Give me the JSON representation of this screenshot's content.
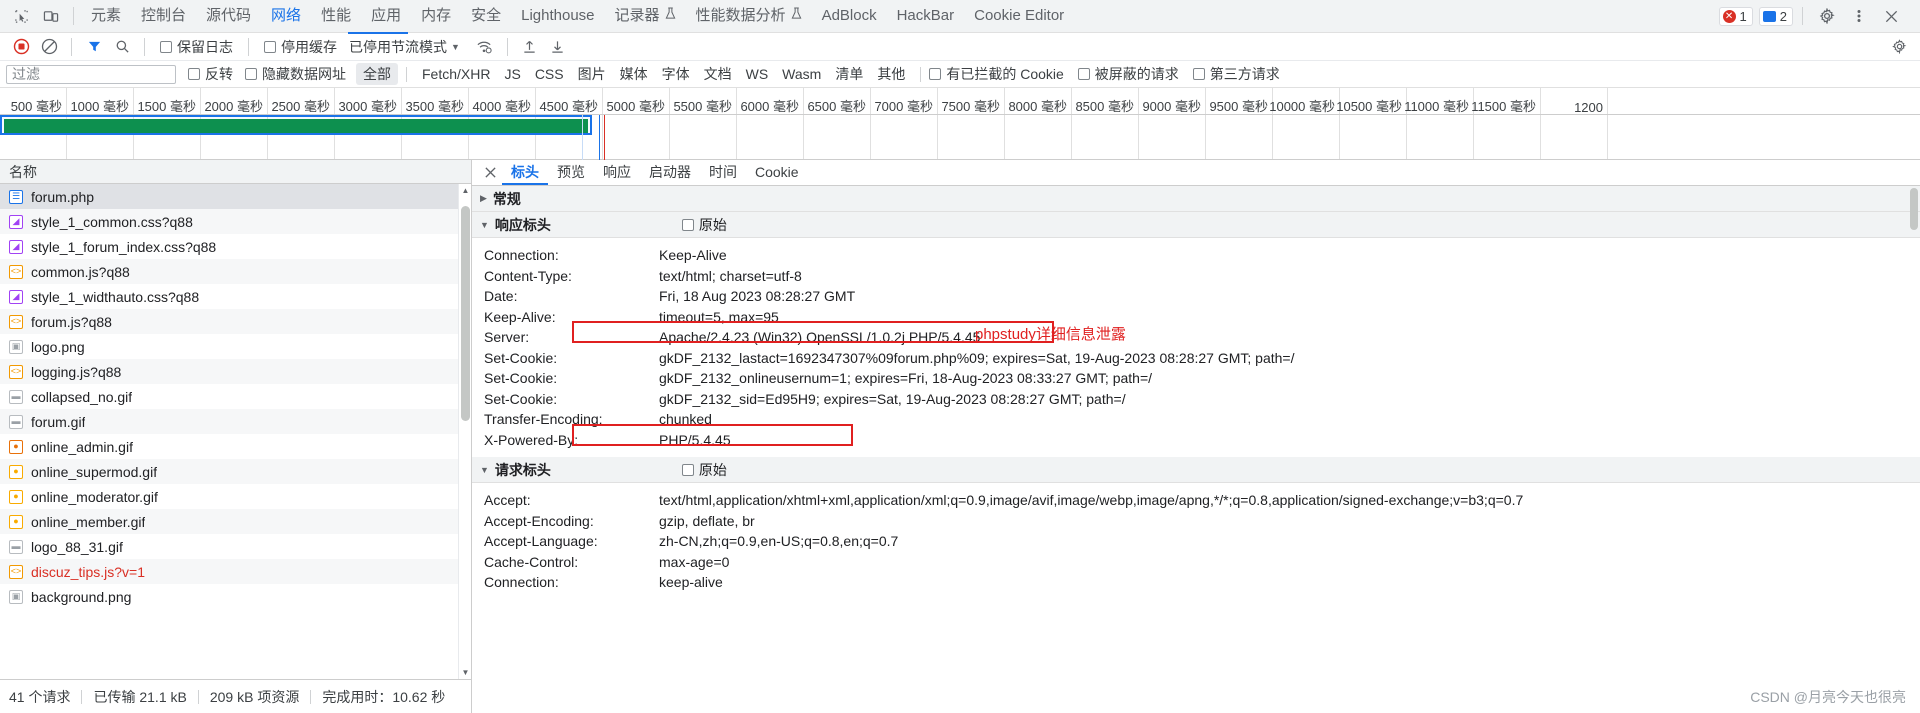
{
  "devtools_tabs": {
    "left_icons": [
      "inspect-icon",
      "device-toolbar-icon"
    ],
    "items": [
      {
        "label": "元素",
        "selected": false
      },
      {
        "label": "控制台",
        "selected": false
      },
      {
        "label": "源代码",
        "selected": false
      },
      {
        "label": "网络",
        "selected": true
      },
      {
        "label": "性能",
        "selected": false
      },
      {
        "label": "应用",
        "selected": false
      },
      {
        "label": "内存",
        "selected": false
      },
      {
        "label": "安全",
        "selected": false
      },
      {
        "label": "Lighthouse",
        "selected": false
      },
      {
        "label": "记录器",
        "selected": false,
        "beaker": true
      },
      {
        "label": "性能数据分析",
        "selected": false,
        "beaker": true
      },
      {
        "label": "AdBlock",
        "selected": false
      },
      {
        "label": "HackBar",
        "selected": false
      },
      {
        "label": "Cookie Editor",
        "selected": false
      }
    ],
    "error_count": "1",
    "message_count": "2",
    "settings_label": "设置",
    "more_label": "更多选项",
    "close_label": "关闭"
  },
  "network_toolbar": {
    "record_label": "停止记录网络日志",
    "clear_label": "清除",
    "filter_label": "过滤",
    "search_label": "搜索",
    "preserve_log": "保留日志",
    "disable_cache": "停用缓存",
    "throttling": "已停用节流模式",
    "wifi_label": "网络状况",
    "import_label": "导入 HAR 文件",
    "export_label": "导出 HAR 文件",
    "settings_label": "网络设置"
  },
  "filter_bar": {
    "placeholder": "过滤",
    "value": "",
    "invert": "反转",
    "hide_data_urls": "隐藏数据网址",
    "types": [
      {
        "label": "全部",
        "selected": true
      },
      {
        "label": "Fetch/XHR",
        "selected": false
      },
      {
        "label": "JS",
        "selected": false
      },
      {
        "label": "CSS",
        "selected": false
      },
      {
        "label": "图片",
        "selected": false
      },
      {
        "label": "媒体",
        "selected": false
      },
      {
        "label": "字体",
        "selected": false
      },
      {
        "label": "文档",
        "selected": false
      },
      {
        "label": "WS",
        "selected": false
      },
      {
        "label": "Wasm",
        "selected": false
      },
      {
        "label": "清单",
        "selected": false
      },
      {
        "label": "其他",
        "selected": false
      }
    ],
    "blocked_cookies": "有已拦截的 Cookie",
    "blocked_requests": "被屏蔽的请求",
    "third_party": "第三方请求"
  },
  "timeline": {
    "ticks": [
      "500 毫秒",
      "1000 毫秒",
      "1500 毫秒",
      "2000 毫秒",
      "2500 毫秒",
      "3000 毫秒",
      "3500 毫秒",
      "4000 毫秒",
      "4500 毫秒",
      "5000 毫秒",
      "5500 毫秒",
      "6000 毫秒",
      "6500 毫秒",
      "7000 毫秒",
      "7500 毫秒",
      "8000 毫秒",
      "8500 毫秒",
      "9000 毫秒",
      "9500 毫秒",
      "10000 毫秒",
      "10500 毫秒",
      "11000 毫秒",
      "11500 毫秒",
      "1200"
    ],
    "selection_color": "#1a73e8",
    "bar_color": "#0d904f"
  },
  "request_list": {
    "column_header": "名称",
    "rows": [
      {
        "name": "forum.php",
        "icon": "document-icon",
        "type": "doc",
        "selected": true
      },
      {
        "name": "style_1_common.css?q88",
        "icon": "stylesheet-icon",
        "type": "css"
      },
      {
        "name": "style_1_forum_index.css?q88",
        "icon": "stylesheet-icon",
        "type": "css"
      },
      {
        "name": "common.js?q88",
        "icon": "script-icon",
        "type": "js"
      },
      {
        "name": "style_1_widthauto.css?q88",
        "icon": "stylesheet-icon",
        "type": "css"
      },
      {
        "name": "forum.js?q88",
        "icon": "script-icon",
        "type": "js"
      },
      {
        "name": "logo.png",
        "icon": "image-icon",
        "type": "img"
      },
      {
        "name": "logging.js?q88",
        "icon": "script-icon",
        "type": "js"
      },
      {
        "name": "collapsed_no.gif",
        "icon": "image-icon",
        "type": "gif"
      },
      {
        "name": "forum.gif",
        "icon": "image-icon",
        "type": "gif"
      },
      {
        "name": "online_admin.gif",
        "icon": "image-icon",
        "type": "person"
      },
      {
        "name": "online_supermod.gif",
        "icon": "image-icon",
        "type": "person2"
      },
      {
        "name": "online_moderator.gif",
        "icon": "image-icon",
        "type": "person2"
      },
      {
        "name": "online_member.gif",
        "icon": "image-icon",
        "type": "person2"
      },
      {
        "name": "logo_88_31.gif",
        "icon": "image-icon",
        "type": "gif"
      },
      {
        "name": "discuz_tips.js?v=1",
        "icon": "script-icon",
        "type": "js",
        "error": true
      },
      {
        "name": "background.png",
        "icon": "image-icon",
        "type": "img"
      }
    ]
  },
  "summary": {
    "requests": "41 个请求",
    "transferred": "已传输 21.1 kB",
    "resources": "209 kB 项资源",
    "finish": "完成用时：10.62 秒"
  },
  "detail": {
    "close_label": "关闭",
    "tabs": [
      {
        "label": "标头",
        "selected": true
      },
      {
        "label": "预览",
        "selected": false
      },
      {
        "label": "响应",
        "selected": false
      },
      {
        "label": "启动器",
        "selected": false
      },
      {
        "label": "时间",
        "selected": false
      },
      {
        "label": "Cookie",
        "selected": false
      }
    ],
    "general_section": "常规",
    "response_section": "响应标头",
    "request_section": "请求标头",
    "raw_label": "原始",
    "response_headers": [
      {
        "key": "Connection:",
        "value": "Keep-Alive"
      },
      {
        "key": "Content-Type:",
        "value": "text/html; charset=utf-8"
      },
      {
        "key": "Date:",
        "value": "Fri, 18 Aug 2023 08:28:27 GMT"
      },
      {
        "key": "Keep-Alive:",
        "value": "timeout=5, max=95"
      },
      {
        "key": "Server:",
        "value": "Apache/2.4.23 (Win32) OpenSSL/1.0.2j PHP/5.4.45"
      },
      {
        "key": "Set-Cookie:",
        "value": "gkDF_2132_lastact=1692347307%09forum.php%09; expires=Sat, 19-Aug-2023 08:28:27 GMT; path=/"
      },
      {
        "key": "Set-Cookie:",
        "value": "gkDF_2132_onlineusernum=1; expires=Fri, 18-Aug-2023 08:33:27 GMT; path=/"
      },
      {
        "key": "Set-Cookie:",
        "value": "gkDF_2132_sid=Ed95H9; expires=Sat, 19-Aug-2023 08:28:27 GMT; path=/"
      },
      {
        "key": "Transfer-Encoding:",
        "value": "chunked"
      },
      {
        "key": "X-Powered-By:",
        "value": "PHP/5.4.45"
      }
    ],
    "request_headers": [
      {
        "key": "Accept:",
        "value": "text/html,application/xhtml+xml,application/xml;q=0.9,image/avif,image/webp,image/apng,*/*;q=0.8,application/signed-exchange;v=b3;q=0.7"
      },
      {
        "key": "Accept-Encoding:",
        "value": "gzip, deflate, br"
      },
      {
        "key": "Accept-Language:",
        "value": "zh-CN,zh;q=0.9,en-US;q=0.8,en;q=0.7"
      },
      {
        "key": "Cache-Control:",
        "value": "max-age=0"
      },
      {
        "key": "Connection:",
        "value": "keep-alive"
      }
    ]
  },
  "annotations": {
    "server_note": "phpstudy详细信息泄露",
    "color": "#e02020"
  },
  "watermark": "CSDN @月亮今天也很亮"
}
